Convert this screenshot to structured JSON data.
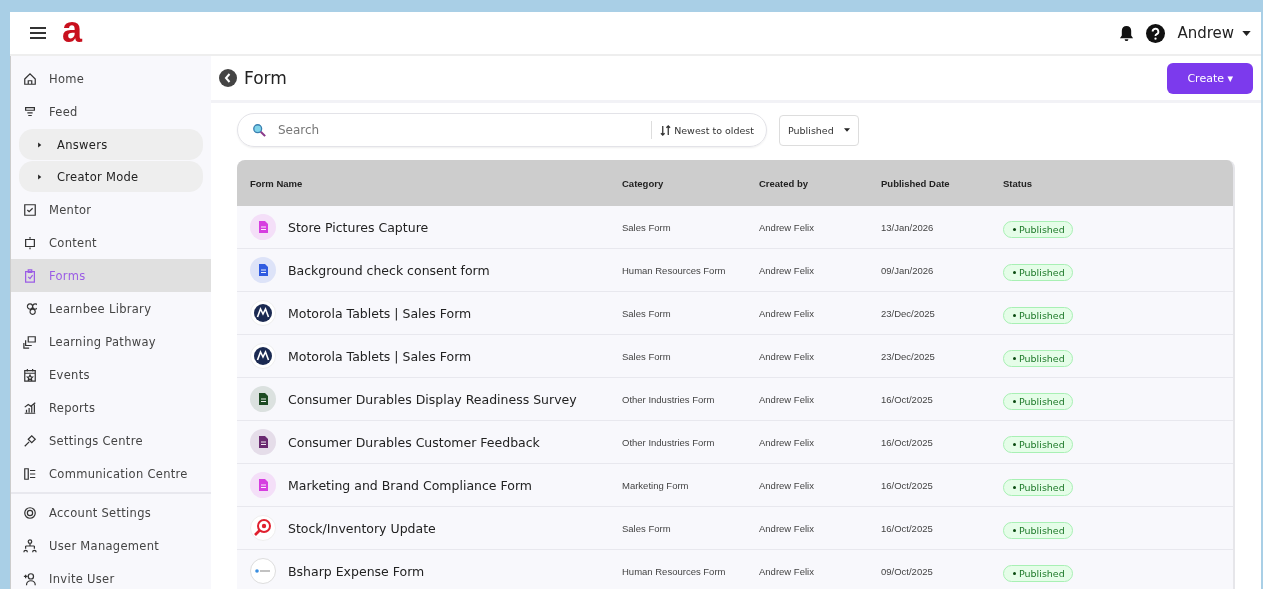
{
  "logo": {
    "text": "a"
  },
  "user": {
    "name": "Andrew"
  },
  "sidebar": {
    "items": [
      {
        "label": "Home",
        "kind": "item",
        "selected": false
      },
      {
        "label": "Feed",
        "kind": "item",
        "selected": false
      },
      {
        "label": "Answers",
        "kind": "expander",
        "selected": false
      },
      {
        "label": "Creator Mode",
        "kind": "expander",
        "selected": false
      },
      {
        "label": "Mentor",
        "kind": "item",
        "selected": false
      },
      {
        "label": "Content",
        "kind": "item",
        "selected": false
      },
      {
        "label": "Forms",
        "kind": "item",
        "selected": true
      },
      {
        "label": "Learnbee Library",
        "kind": "item",
        "selected": false
      },
      {
        "label": "Learning Pathway",
        "kind": "item",
        "selected": false
      },
      {
        "label": "Events",
        "kind": "item",
        "selected": false
      },
      {
        "label": "Reports",
        "kind": "item",
        "selected": false
      },
      {
        "label": "Settings Centre",
        "kind": "item",
        "selected": false
      },
      {
        "label": "Communication Centre",
        "kind": "item",
        "selected": false
      },
      {
        "label": "Account Settings",
        "kind": "item",
        "selected": false
      },
      {
        "label": "User Management",
        "kind": "item",
        "selected": false
      },
      {
        "label": "Invite User",
        "kind": "item",
        "selected": false
      }
    ]
  },
  "page": {
    "title": "Form",
    "create_button": "Create ▾"
  },
  "search": {
    "placeholder": "Search"
  },
  "sort": {
    "label": "Newest to oldest"
  },
  "filter": {
    "value": "Published"
  },
  "table": {
    "columns": [
      "Form Name",
      "Category",
      "Created by",
      "Published Date",
      "Status"
    ],
    "rows": [
      {
        "kind": "doc",
        "color": "#d63ee0",
        "name": "Store Pictures Capture",
        "category": "Sales Form",
        "created_by": "Andrew Felix",
        "date": "13/Jan/2026",
        "status": "Published"
      },
      {
        "kind": "doc",
        "color": "#2f5be0",
        "name": "Background check consent form",
        "category": "Human Resources Form",
        "created_by": "Andrew Felix",
        "date": "09/Jan/2026",
        "status": "Published"
      },
      {
        "kind": "brand",
        "name": "Motorola Tablets | Sales Form",
        "category": "Sales Form",
        "created_by": "Andrew Felix",
        "date": "23/Dec/2025",
        "status": "Published"
      },
      {
        "kind": "brand",
        "name": "Motorola Tablets | Sales Form",
        "category": "Sales Form",
        "created_by": "Andrew Felix",
        "date": "23/Dec/2025",
        "status": "Published"
      },
      {
        "kind": "doc",
        "color": "#1d4a22",
        "name": "Consumer Durables Display Readiness Survey",
        "category": "Other Industries Form",
        "created_by": "Andrew Felix",
        "date": "16/Oct/2025",
        "status": "Published"
      },
      {
        "kind": "doc",
        "color": "#6a2a70",
        "name": "Consumer Durables Customer Feedback",
        "category": "Other Industries Form",
        "created_by": "Andrew Felix",
        "date": "16/Oct/2025",
        "status": "Published"
      },
      {
        "kind": "doc",
        "color": "#d63ee0",
        "name": "Marketing and Brand Compliance Form",
        "category": "Marketing Form",
        "created_by": "Andrew Felix",
        "date": "16/Oct/2025",
        "status": "Published"
      },
      {
        "kind": "magnifier",
        "name": "Stock/Inventory Update",
        "category": "Sales Form",
        "created_by": "Andrew Felix",
        "date": "16/Oct/2025",
        "status": "Published"
      },
      {
        "kind": "badge",
        "name": "Bsharp Expense Form",
        "category": "Human Resources Form",
        "created_by": "Andrew Felix",
        "date": "09/Oct/2025",
        "status": "Published"
      }
    ]
  }
}
